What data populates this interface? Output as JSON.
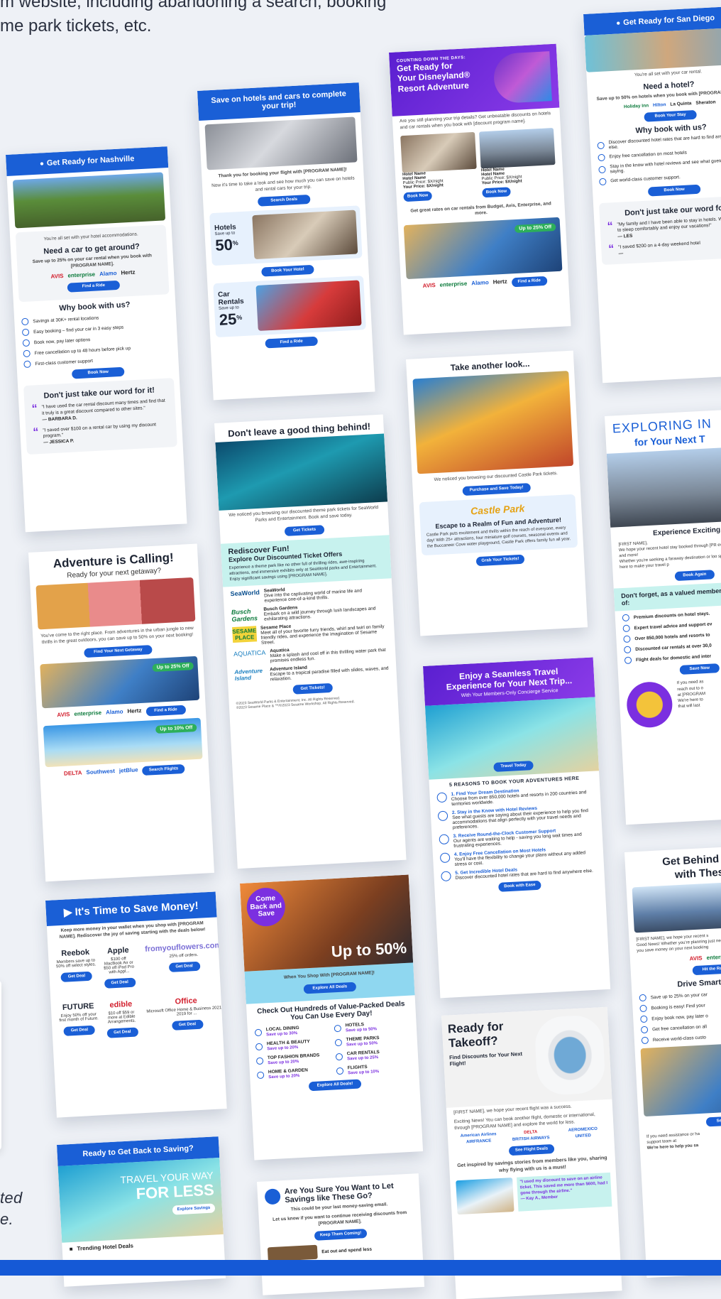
{
  "intro": {
    "line1": "m website, including abandoning a search, booking",
    "line2": "me park tickets, etc."
  },
  "side_note": {
    "line1": "ted",
    "line2": "e."
  },
  "cards": {
    "nashville": {
      "title": "Get Ready for Nashville",
      "lead": "You're all set with your hotel accommodations.",
      "heading": "Need a car to get around?",
      "offer": "Save up to 25% on your car rental when you book with [PROGRAM NAME].",
      "logos": [
        "AVIS",
        "enterprise",
        "Alamo",
        "Hertz"
      ],
      "button": "Find a Ride",
      "why_title": "Why book with us?",
      "benefits": [
        "Savings at 30K+ rental locations",
        "Easy booking – find your car in 3 easy steps",
        "Book now, pay later options",
        "Free cancellation up to 48 hours before pick up",
        "First-class customer support"
      ],
      "button2": "Book Now",
      "testimonial_title": "Don't just take our word for it!",
      "quotes": [
        {
          "text": "\"I have used the car rental discount many times and find that it truly is a great discount compared to other sites.\"",
          "author": "— BARBARA D."
        },
        {
          "text": "\"I saved over $100 on a rental car by using my discount program.\"",
          "author": "— JESSICA P."
        }
      ]
    },
    "adventure": {
      "title": "Adventure is Calling!",
      "subtitle": "Ready for your next getaway?",
      "body": "You've come to the right place. From adventures in the urban jungle to new thrills in the great outdoors, you can save up to 50% on your next booking!",
      "button": "Find Your Next Getaway",
      "car_badge": "Up to 25% Off",
      "car_logos": [
        "AVIS",
        "enterprise",
        "Alamo",
        "Hertz"
      ],
      "car_button": "Find a Ride",
      "flight_badge": "Up to 10% Off",
      "flight_logos": [
        "DELTA",
        "Southwest",
        "jetBlue"
      ],
      "flight_button": "Search Flights"
    },
    "save_money": {
      "title_pre": "It's Time to ",
      "title_strong": "Save Money!",
      "intro": "Keep more money in your wallet when you shop with [PROGRAM NAME]. Rediscover the joy of saving starting with the deals below!",
      "deals": [
        {
          "brand": "Reebok",
          "text": "Members save up to 50% off select styles.",
          "button": "Get Deal"
        },
        {
          "brand": "Apple",
          "text": "$100 off MacBook Air or $50 off iPad Pro with Appl...",
          "button": "Get Deal"
        },
        {
          "brand": "fromyouflowers.com",
          "text": "25% off orders.",
          "button": "Get Deal"
        },
        {
          "brand": "FUTURE",
          "text": "Enjoy 50% off your first month of Future.",
          "button": "Get Deal"
        },
        {
          "brand": "edible",
          "text": "$10 off $59 or more at Edible Arrangements.",
          "button": "Get Deal"
        },
        {
          "brand": "Office",
          "text": "Microsoft Office Home & Business 2021 or 2019 for ...",
          "button": "Get Deal"
        }
      ]
    },
    "travel_less": {
      "title": "Ready to Get Back to Saving?",
      "hero_line1": "TRAVEL YOUR WAY",
      "hero_line2": "FOR LESS",
      "button": "Explore Savings",
      "section": "Trending Hotel Deals"
    },
    "hotels_cars": {
      "title": "Save on hotels and cars to complete your trip!",
      "thanks": "Thank you for booking your flight with [PROGRAM NAME]!",
      "body": "Now it's time to take a look and see how much you can save on hotels and rental cars for your trip.",
      "button": "Search Deals",
      "hotels_label": "Hotels",
      "hotels_save": "Save up to",
      "hotels_value": "50",
      "hotels_button": "Book Your Hotel",
      "cars_label": "Car Rentals",
      "cars_save": "Save up to",
      "cars_value": "25",
      "cars_button": "Find a Ride",
      "percent": "%"
    },
    "seaworld": {
      "title": "Don't leave a good thing behind!",
      "body": "We noticed you browsing our discounted theme park tickets for SeaWorld Parks and Entertainment. Book and save today.",
      "button": "Get Tickets",
      "rediscover": "Rediscover Fun!",
      "offers": "Explore Our Discounted Ticket Offers",
      "offers_body": "Experience a theme park like no other full of thrilling rides, awe-inspiring attractions, and immersive exhibits only at SeaWorld parks and Entertainment. Enjoy significant savings using [PROGRAM NAME].",
      "parks": [
        {
          "logo": "SeaWorld",
          "name": "SeaWorld",
          "desc": "Dive into the captivating world of marine life and experience one-of-a-kind thrills."
        },
        {
          "logo": "Busch Gardens",
          "name": "Busch Gardens",
          "desc": "Embark on a wild journey through lush landscapes and exhilarating attractions."
        },
        {
          "logo": "SESAME PLACE",
          "name": "Sesame Place",
          "desc": "Meet all of your favorite furry friends, whirl and twirl on family friendly rides, and experience the imagination of Sesame Street."
        },
        {
          "logo": "AQUATICA",
          "name": "Aquatica",
          "desc": "Make a splash and cool off in this thrilling water park that promises endless fun."
        },
        {
          "logo": "Adventure Island",
          "name": "Adventure Island",
          "desc": "Escape to a tropical paradise filled with slides, waves, and relaxation."
        }
      ],
      "button2": "Get Tickets!",
      "legal1": "©2023 SeaWorld Parks & Entertainment, Inc. All Rights Reserved.",
      "legal2": "©2023 Sesame Place & ™/©2023 Sesame Workshop. All Rights Reserved."
    },
    "come_back": {
      "badge": "Come Back and Save",
      "hero": "Up to 50%",
      "cta_line": "When You Shop With [PROGRAM NAME]!",
      "button": "Explore All Deals",
      "heading": "Check Out Hundreds of Value-Packed Deals You Can Use Every Day!",
      "deals": [
        {
          "name": "LOCAL DINING",
          "save": "Save up to 30%"
        },
        {
          "name": "HOTELS",
          "save": "Save up to 50%"
        },
        {
          "name": "HEALTH & BEAUTY",
          "save": "Save up to 20%"
        },
        {
          "name": "THEME PARKS",
          "save": "Save up to 50%"
        },
        {
          "name": "TOP FASHION BRANDS",
          "save": "Save up to 20%"
        },
        {
          "name": "CAR RENTALS",
          "save": "Save up to 25%"
        },
        {
          "name": "HOME & GARDEN",
          "save": "Save up to 20%"
        },
        {
          "name": "FLIGHTS",
          "save": "Save up to 10%"
        }
      ],
      "button2": "Explore All Deals!"
    },
    "unsubscribe": {
      "title": "Are You Sure You Want to Let Savings like These Go?",
      "body": "This could be your last money-saving email.",
      "body2": "Let us know if you want to continue receiving discounts from [PROGRAM NAME].",
      "button": "Keep Them Coming!",
      "teaser": "Eat out and spend less"
    },
    "disney": {
      "kicker": "COUNTING DOWN THE DAYS:",
      "title_line1": "Get Ready for",
      "title_line2": "Your Disneyland®",
      "title_line3": "Resort Adventure",
      "body": "Are you still planning your trip details? Get unbeatable discounts on hotels and car rentals when you book with [discount program name].",
      "hotels": [
        {
          "name1": "Hotel Name",
          "name2": "Hotel Name",
          "public": "Public Price: $X/night",
          "your": "Your Price: $X/night",
          "button": "Book Now"
        },
        {
          "name1": "Hotel Name",
          "name2": "Hotel Name",
          "public": "Public Price: $X/night",
          "your": "Your Price: $X/night",
          "button": "Book Now"
        }
      ],
      "car_line": "Get great rates on car rentals from Budget, Avis, Enterprise, and more.",
      "car_badge": "Up to 25% Off",
      "logos": [
        "AVIS",
        "enterprise",
        "Alamo",
        "Hertz"
      ],
      "button": "Find a Ride"
    },
    "castle_park": {
      "title": "Take another look...",
      "body": "We noticed you browsing our discounted Castle Park tickets.",
      "button": "Purchase and Save Today!",
      "logo": "Castle Park",
      "heading": "Escape to a Realm of Fun and Adventure!",
      "desc": "Castle Park puts excitement and thrills within the reach of everyone, every day! With 25+ attractions, four miniature golf courses, seasonal events and the Buccaneer Cove water playground, Castle Park offers family fun all year.",
      "button2": "Grab Your Tickets!"
    },
    "concierge": {
      "title_line1": "Enjoy a Seamless Travel",
      "title_line2": "Experience for Your Next Trip...",
      "subtitle": "With Your Members-Only Concierge Service",
      "hero_button": "Travel Today",
      "section": "5 REASONS TO BOOK YOUR ADVENTURES HERE",
      "reasons": [
        {
          "title": "1. Find Your Dream Destination",
          "text": "Choose from over 850,000 hotels and resorts in 200 countries and territories worldwide."
        },
        {
          "title": "2. Stay in the Know with Hotel Reviews",
          "text": "See what guests are saying about their experience to help you find accommodations that align perfectly with your travel needs and preferences."
        },
        {
          "title": "3. Receive Round-the-Clock Customer Support",
          "text": "Our agents are waiting to help - saving you long wait times and frustrating experiences."
        },
        {
          "title": "4. Enjoy Free Cancellation on Most Hotels",
          "text": "You'll have the flexibility to change your plans without any added stress or cost."
        },
        {
          "title": "5. Get Incredible Hotel Deals",
          "text": "Discover discounted hotel rates that are hard to find anywhere else."
        }
      ],
      "button": "Book with Ease"
    },
    "takeoff": {
      "title_line1": "Ready for",
      "title_line2": "Takeoff?",
      "subtitle": "Find Discounts for Your Next Flight!",
      "body": "[FIRST NAME], we hope your recent flight was a success.",
      "body2": "Exciting News! You can book another flight, domestic or international, through [PROGRAM NAME] and explore the world for less.",
      "logos": [
        "American Airlines",
        "DELTA",
        "AEROMEXICO",
        "AIRFRANCE",
        "BRITISH AIRWAYS",
        "UNITED"
      ],
      "button": "See Flight Deals",
      "inspire": "Get inspired by savings stories from members like you, sharing why flying with us is a must!",
      "quote": "\"I used my discount to save on an airline ticket. This saved me more than $600, had I gone through the airline.\"",
      "quote_author": "— Kay A., Member"
    },
    "san_diego": {
      "title": "Get Ready for San Diego",
      "lead": "You're all set with your car rental.",
      "heading": "Need a hotel?",
      "offer": "Save up to 50% on hotels when you book with [PROGRAM NAME].",
      "logos": [
        "Holiday Inn",
        "Hilton",
        "La Quinta",
        "Sheraton"
      ],
      "button": "Book Your Stay",
      "why_title": "Why book with us?",
      "benefits": [
        "Discover discounted hotel rates that are hard to find anywhere else.",
        "Enjoy free cancellation on most hotels",
        "Stay in the know with hotel reviews and see what guests are saying.",
        "Get world-class customer support."
      ],
      "button2": "Book Now",
      "testimonial_title": "Don't just take our word for",
      "quotes": [
        {
          "text": "\"My family and I have been able to stay in hotels. We are able to sleep comfortably and enjoy our vacations!\"",
          "author": "— LES"
        },
        {
          "text": "\"I saved $200 on a 4-day weekend hotel",
          "author": "—"
        }
      ]
    },
    "exploring": {
      "title_line1": "EXPLORING IN",
      "title_line2": "for Your Next T",
      "section": "Experience Exciting Cit",
      "body1": "[FIRST NAME],",
      "body2": "We hope your recent hotel stay booked through [PR everything you hoped for and more!",
      "body3": "Whether you're seeking a faraway destination or loo spot close to home, we're here to make your travel p",
      "button": "Book Again",
      "member_title": "Don't forget, as a valued member take advantage of:",
      "benefits": [
        "Premium discounts on hotel stays.",
        "Expert travel advice and support ev",
        "Over 850,000 hotels and resorts to",
        "Discounted car rentals at over 30,0",
        "Flight deals for domestic and inter"
      ],
      "button2": "Save Now",
      "help1": "If you need as",
      "help2": "reach out to o",
      "help3": "at [PROGRAM",
      "help4": "We're here to",
      "help5": "that will last"
    },
    "get_behind": {
      "title_line1": "Get Behind the W",
      "title_line2": "with These S",
      "body1": "[FIRST NAME], we hope your recent s",
      "body2": "Good News! Whether you're planning just need a set of wheels for your next you save money on your next booking",
      "logos": [
        "AVIS",
        "enterprise"
      ],
      "button": "Hit the Ro",
      "drive_title": "Drive Smart with [P",
      "benefits": [
        "Save up to 25% on your car",
        "Booking is easy! Find your",
        "Enjoy book now, pay later o",
        "Get free cancellation on all",
        "Receive world-class custo"
      ],
      "button2": "See",
      "help1": "If you need assistance or ha",
      "help2": "support team at",
      "help3": "We're here to help you sa"
    }
  }
}
